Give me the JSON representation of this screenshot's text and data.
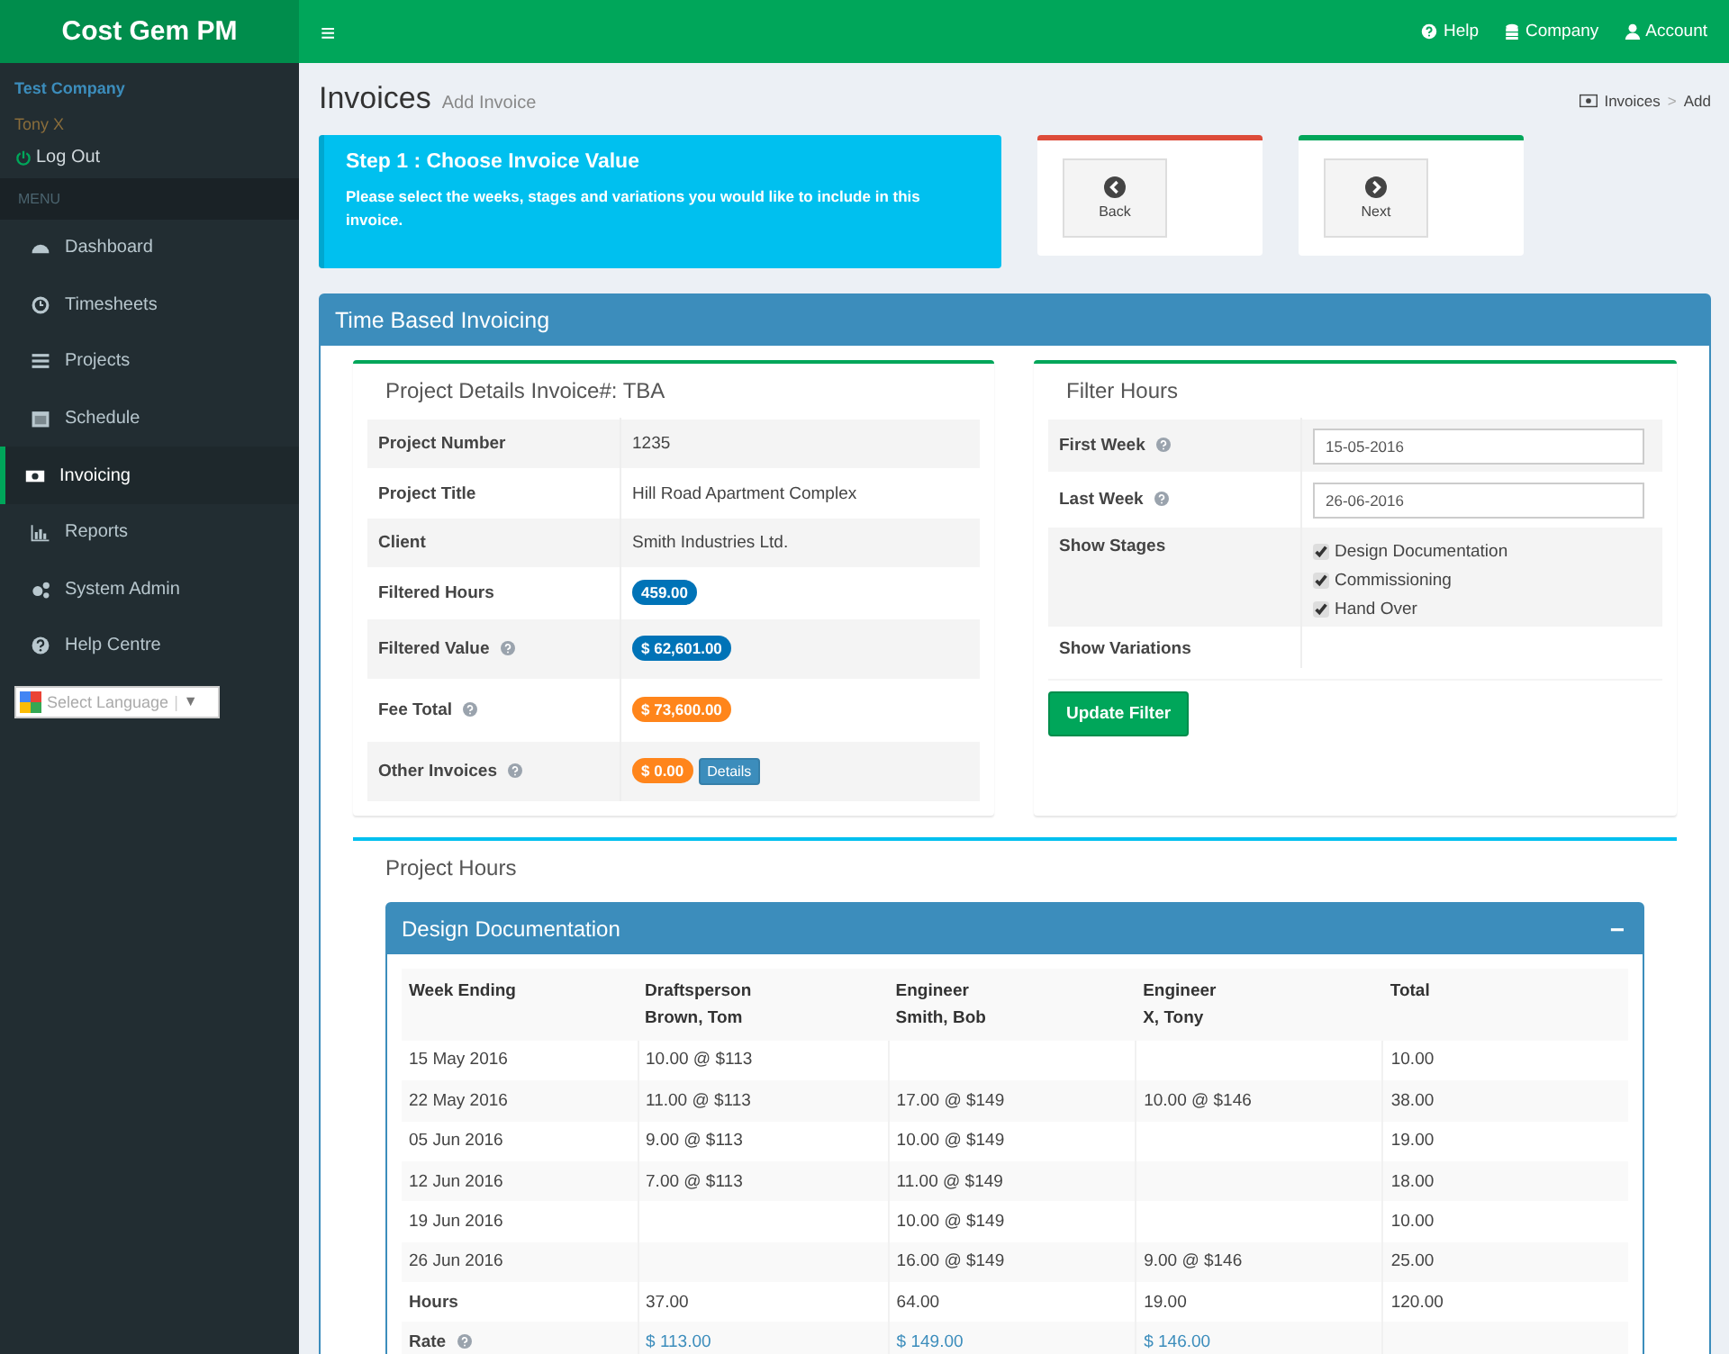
{
  "brand": "Cost Gem PM",
  "topbar": {
    "menu_icon": "≡",
    "links": [
      {
        "label": "Help"
      },
      {
        "label": "Company"
      },
      {
        "label": "Account"
      }
    ]
  },
  "user": {
    "company": "Test Company",
    "name": "Tony X",
    "logout": "Log Out"
  },
  "sidebar": {
    "header": "MENU",
    "items": [
      {
        "label": "Dashboard",
        "selected": false
      },
      {
        "label": "Timesheets",
        "selected": false
      },
      {
        "label": "Projects",
        "selected": false
      },
      {
        "label": "Schedule",
        "selected": false
      },
      {
        "label": "Invoicing",
        "selected": true
      },
      {
        "label": "Reports",
        "selected": false
      },
      {
        "label": "System Admin",
        "selected": false
      },
      {
        "label": "Help Centre",
        "selected": false
      }
    ],
    "language": "Select Language",
    "language_separator": "|",
    "language_caret": "▼"
  },
  "page": {
    "title": "Invoices",
    "subtitle": "Add Invoice",
    "breadcrumb": [
      "Invoices",
      "Add"
    ],
    "breadcrumb_separator": ">"
  },
  "step": {
    "title": "Step 1 : Choose Invoice Value",
    "text": "Please select the weeks, stages and variations you would like to include in this invoice."
  },
  "nav_buttons": [
    {
      "label": "Back",
      "kind": "back"
    },
    {
      "label": "Next",
      "kind": "next"
    }
  ],
  "panel_title": "Time Based Invoicing",
  "details": {
    "title": "Project Details Invoice#: TBA",
    "rows": [
      {
        "label": "Project Number",
        "help": false,
        "value": {
          "kind": "text",
          "text": "1235"
        }
      },
      {
        "label": "Project Title",
        "help": false,
        "value": {
          "kind": "text",
          "text": "Hill Road Apartment Complex"
        }
      },
      {
        "label": "Client",
        "help": false,
        "value": {
          "kind": "text",
          "text": "Smith Industries Ltd."
        }
      },
      {
        "label": "Filtered Hours",
        "help": false,
        "value": {
          "kind": "badge",
          "text": "459.00",
          "color": "#0073b7"
        }
      },
      {
        "label": "Filtered Value",
        "help": true,
        "value": {
          "kind": "badge",
          "text": "$ 62,601.00",
          "color": "#0073b7"
        }
      },
      {
        "label": "Fee Total",
        "help": true,
        "value": {
          "kind": "badge",
          "text": "$ 73,600.00",
          "color": "#ff851b"
        }
      },
      {
        "label": "Other Invoices",
        "help": true,
        "value": {
          "kind": "badge",
          "text": "$ 0.00",
          "color": "#ff851b"
        },
        "button": "Details"
      }
    ]
  },
  "filter": {
    "title": "Filter Hours",
    "rows": [
      {
        "label": "First Week",
        "help": true,
        "kind": "date",
        "value": "15-05-2016"
      },
      {
        "label": "Last Week",
        "help": true,
        "kind": "date",
        "value": "26-06-2016"
      },
      {
        "label": "Show Stages",
        "help": false,
        "kind": "checks",
        "options": [
          {
            "label": "Design Documentation",
            "checked": true
          },
          {
            "label": "Commissioning",
            "checked": true
          },
          {
            "label": "Hand Over",
            "checked": true
          }
        ]
      },
      {
        "label": "Show Variations",
        "help": false,
        "kind": "empty"
      }
    ],
    "button": "Update Filter"
  },
  "hours": {
    "title": "Project Hours",
    "stage": {
      "title": "Design Documentation",
      "toggle": "−",
      "columns": [
        "Week Ending",
        "Draftsperson\nBrown, Tom",
        "Engineer\nSmith, Bob",
        "Engineer\nX, Tony",
        "Total"
      ],
      "rows": [
        {
          "kind": "week",
          "help": false,
          "cells": [
            "15 May 2016",
            "10.00  @ $113",
            null,
            null,
            "10.00"
          ]
        },
        {
          "kind": "week",
          "help": false,
          "cells": [
            "22 May 2016",
            "11.00  @ $113",
            "17.00  @ $149",
            "10.00  @ $146",
            "38.00"
          ]
        },
        {
          "kind": "week",
          "help": false,
          "cells": [
            "05 Jun 2016",
            "9.00  @ $113",
            "10.00  @ $149",
            null,
            "19.00"
          ]
        },
        {
          "kind": "week",
          "help": false,
          "cells": [
            "12 Jun 2016",
            "7.00  @ $113",
            "11.00  @ $149",
            null,
            "18.00"
          ]
        },
        {
          "kind": "week",
          "help": false,
          "cells": [
            "19 Jun 2016",
            null,
            "10.00  @ $149",
            null,
            "10.00"
          ]
        },
        {
          "kind": "week",
          "help": false,
          "cells": [
            "26 Jun 2016",
            null,
            "16.00  @ $149",
            "9.00  @ $146",
            "25.00"
          ]
        },
        {
          "kind": "hours",
          "help": false,
          "cells": [
            "Hours",
            "37.00",
            "64.00",
            "19.00",
            "120.00"
          ]
        },
        {
          "kind": "rate",
          "help": true,
          "cells": [
            "Rate",
            "$ 113.00",
            "$ 149.00",
            "$ 146.00",
            null
          ]
        }
      ]
    }
  }
}
